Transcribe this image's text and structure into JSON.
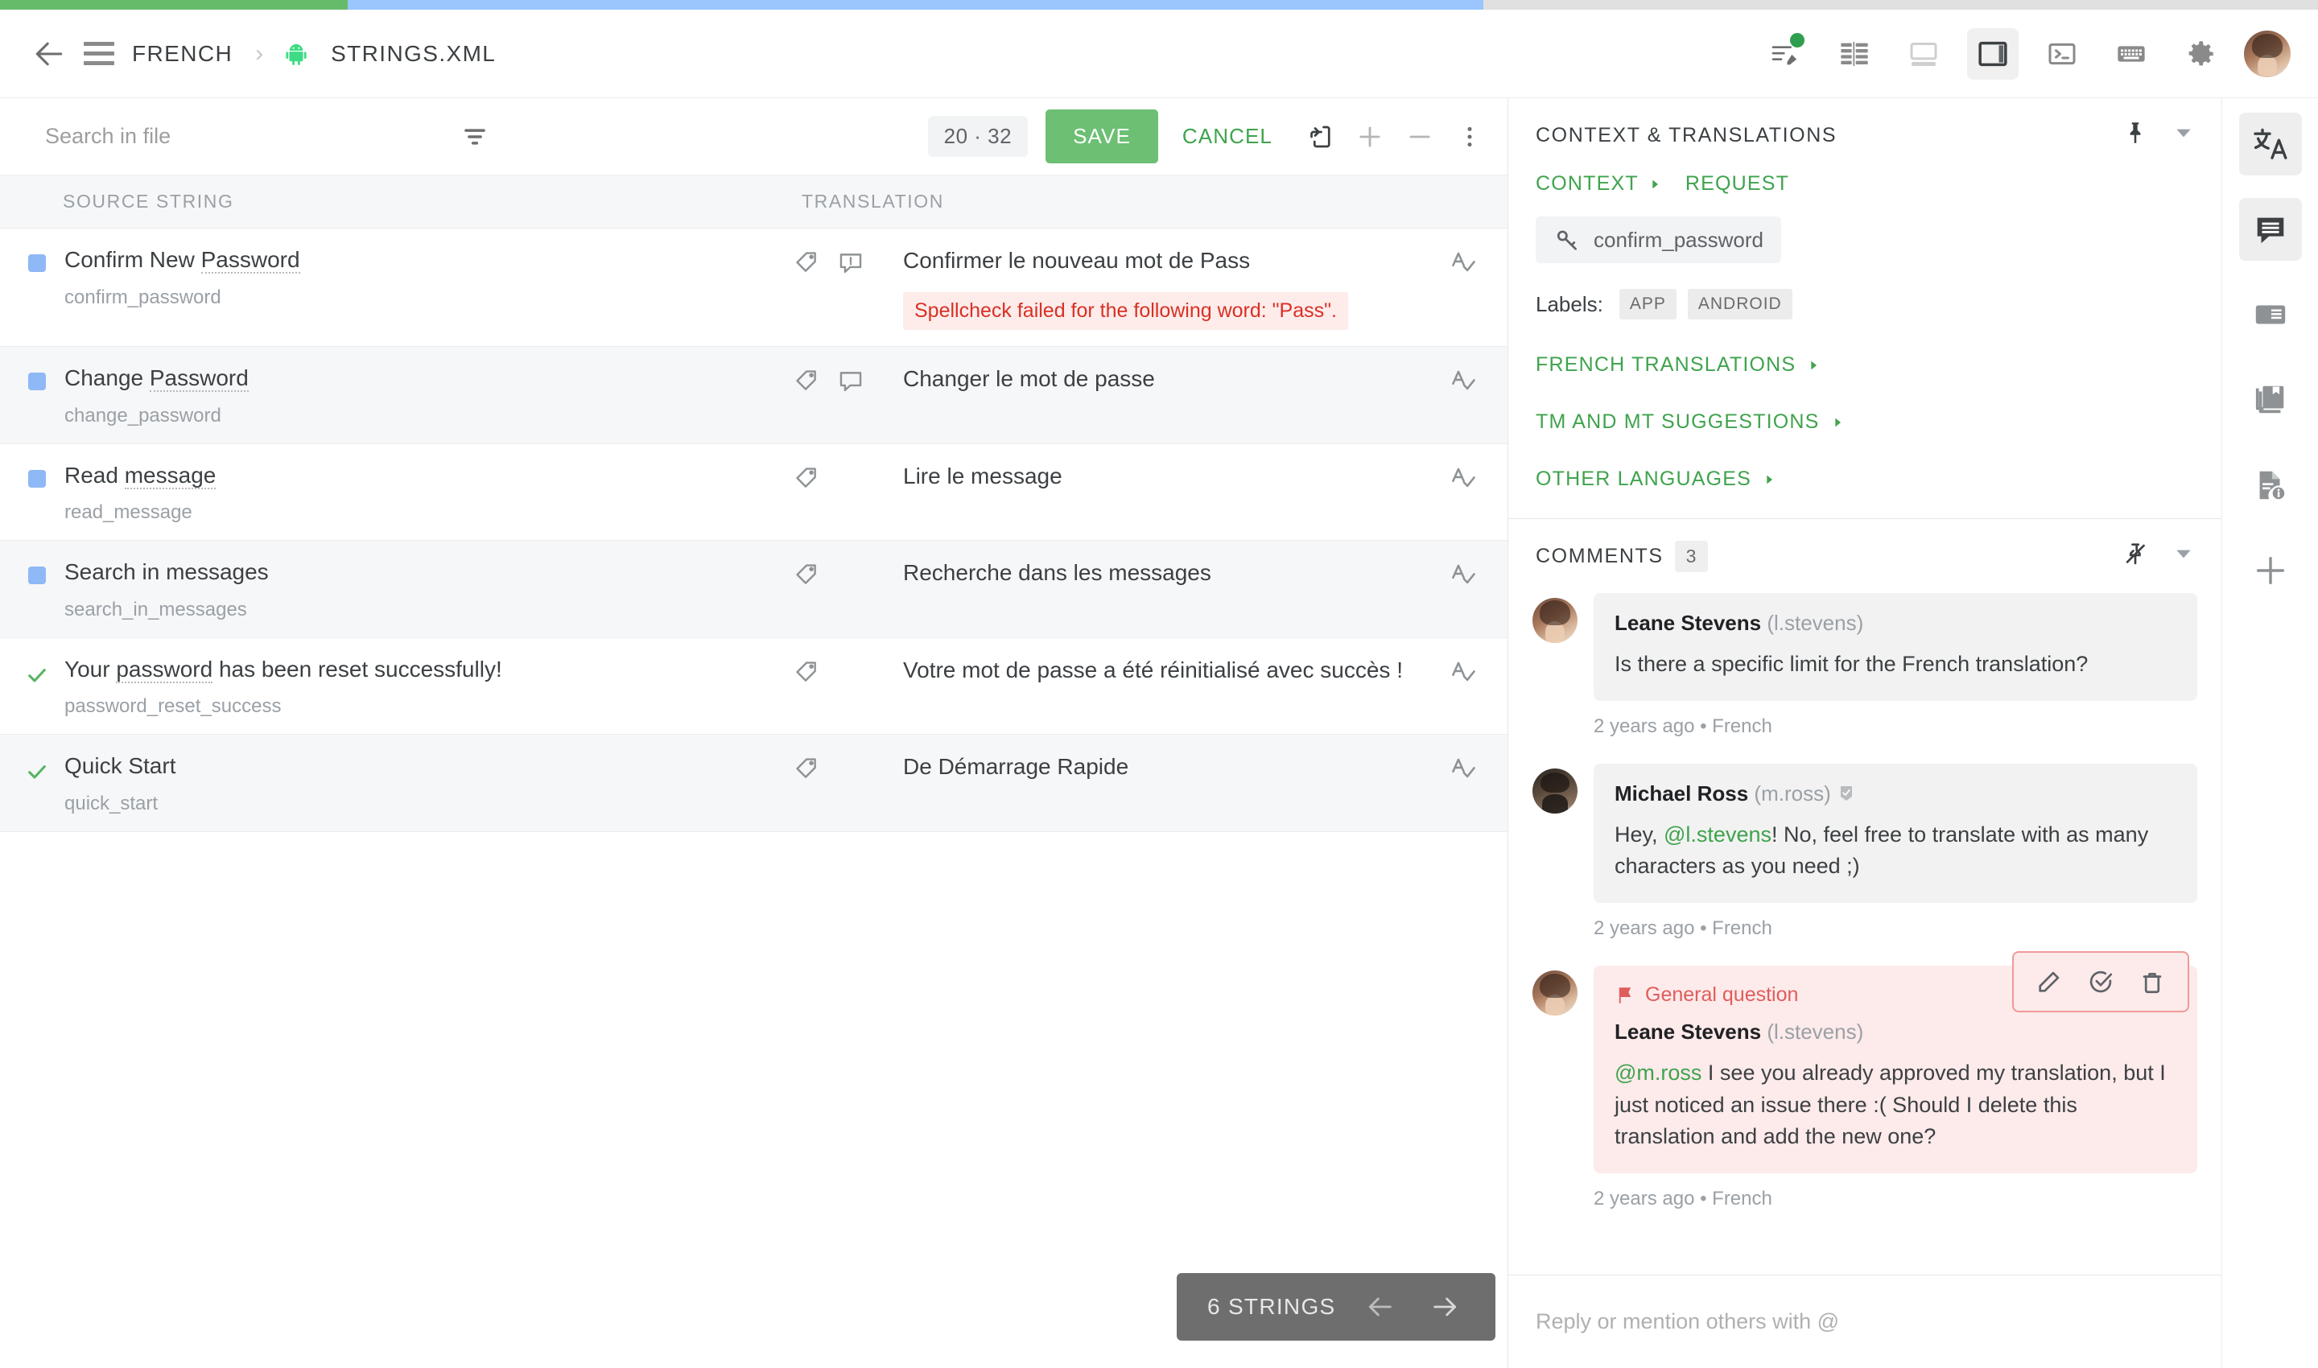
{
  "progress": {
    "green_pct": 15,
    "blue_pct": 49,
    "gray_pct": 36
  },
  "header": {
    "back_icon": "back-arrow-icon",
    "menu_icon": "hamburger-menu-icon",
    "breadcrumb_language": "FRENCH",
    "breadcrumb_separator": "›",
    "android_icon": "android-robot-icon",
    "breadcrumb_file": "STRINGS.XML",
    "tools": [
      {
        "name": "edit-mode-icon",
        "badge": true
      },
      {
        "name": "table-view-icon",
        "badge": false
      },
      {
        "name": "bottom-panel-layout-icon",
        "badge": false
      },
      {
        "name": "side-panel-layout-icon",
        "badge": false,
        "active": true
      },
      {
        "name": "console-icon",
        "badge": false
      },
      {
        "name": "keyboard-shortcuts-icon",
        "badge": false
      },
      {
        "name": "settings-gear-icon",
        "badge": false
      }
    ],
    "avatar": "user-avatar"
  },
  "toolbar": {
    "search_placeholder": "Search in file",
    "search_value": "",
    "filter_icon": "filter-icon",
    "counter": "20 · 32",
    "save_label": "SAVE",
    "cancel_label": "CANCEL",
    "copy_icon": "copy-source-icon",
    "plus_icon": "plus-icon",
    "minus_icon": "minus-icon",
    "more_icon": "more-vertical-icon"
  },
  "list": {
    "col_source": "SOURCE STRING",
    "col_translation": "TRANSLATION",
    "rows": [
      {
        "status": "blue",
        "source_pre": "Confirm New ",
        "source_spell": "Password",
        "source_post": "",
        "key": "confirm_password",
        "icons": [
          "tag-icon",
          "comment-alert-icon"
        ],
        "translation": "Confirmer le nouveau mot de Pass",
        "warning": "Spellcheck failed for the following word: \"Pass\".",
        "right_icon": "spellcheck-icon"
      },
      {
        "status": "blue",
        "source_pre": "Change ",
        "source_spell": "Password",
        "source_post": "",
        "key": "change_password",
        "icons": [
          "tag-icon",
          "comment-icon"
        ],
        "translation": "Changer le mot de passe",
        "warning": "",
        "right_icon": "spellcheck-icon"
      },
      {
        "status": "blue",
        "source_pre": "Read ",
        "source_spell": "message",
        "source_post": "",
        "key": "read_message",
        "icons": [
          "tag-icon"
        ],
        "translation": "Lire le message",
        "warning": "",
        "right_icon": "spellcheck-icon"
      },
      {
        "status": "blue",
        "source_pre": "Search in messages",
        "source_spell": "",
        "source_post": "",
        "key": "search_in_messages",
        "icons": [
          "tag-icon"
        ],
        "translation": "Recherche dans les messages",
        "warning": "",
        "right_icon": "spellcheck-icon"
      },
      {
        "status": "check",
        "source_pre": "Your ",
        "source_spell": "password",
        "source_post": " has been reset successfully!",
        "key": "password_reset_success",
        "icons": [
          "tag-icon"
        ],
        "translation": "Votre mot de passe a été réinitialisé avec succès !",
        "warning": "",
        "right_icon": "spellcheck-icon"
      },
      {
        "status": "check",
        "source_pre": "Quick Start",
        "source_spell": "",
        "source_post": "",
        "key": "quick_start",
        "icons": [
          "tag-icon"
        ],
        "translation": "De Démarrage Rapide",
        "warning": "",
        "right_icon": "spellcheck-icon"
      }
    ],
    "strings_pill": {
      "label": "6 STRINGS",
      "prev_icon": "arrow-left-icon",
      "next_icon": "arrow-right-icon"
    }
  },
  "context_panel": {
    "title": "CONTEXT & TRANSLATIONS",
    "pin_icon": "pin-icon",
    "collapse_icon": "chevron-down-icon",
    "link_context": "CONTEXT",
    "link_request": "REQUEST",
    "key_icon": "key-icon",
    "key_value": "confirm_password",
    "labels_title": "Labels:",
    "labels": [
      "APP",
      "ANDROID"
    ],
    "groups": [
      {
        "label": "FRENCH TRANSLATIONS"
      },
      {
        "label": "TM AND MT SUGGESTIONS"
      },
      {
        "label": "OTHER LANGUAGES"
      }
    ]
  },
  "comments_panel": {
    "title": "COMMENTS",
    "count": "3",
    "unpin_icon": "unpin-icon",
    "collapse_icon": "chevron-down-icon",
    "items": [
      {
        "avatar": "leane-avatar",
        "name": "Leane Stevens",
        "handle": "(l.stevens)",
        "verified": false,
        "flag": "",
        "text_plain": "Is there a specific limit for the French translation?",
        "mention": "",
        "text_after": "",
        "meta": "2 years ago • French",
        "flagged": false
      },
      {
        "avatar": "michael-avatar",
        "name": "Michael Ross",
        "handle": "(m.ross)",
        "verified": true,
        "flag": "",
        "text_before": "Hey, ",
        "mention": "@l.stevens",
        "text_after": "! No, feel free to translate with as many characters as you need ;)",
        "meta": "2 years ago • French",
        "flagged": false
      },
      {
        "avatar": "leane-avatar",
        "name": "Leane Stevens",
        "handle": "(l.stevens)",
        "verified": false,
        "flag_icon": "flag-icon",
        "flag": "General question",
        "text_before": "",
        "mention": "@m.ross",
        "text_after": " I see you already approved my translation, but I just noticed an issue there :( Should I delete this translation and add the new one?",
        "meta": "2 years ago • French",
        "flagged": true,
        "actions": [
          {
            "name": "edit-comment-icon"
          },
          {
            "name": "resolve-comment-icon"
          },
          {
            "name": "delete-comment-icon"
          }
        ]
      }
    ],
    "reply_placeholder": "Reply or mention others with @"
  },
  "right_rail": {
    "items": [
      {
        "name": "translate-icon",
        "active": true
      },
      {
        "name": "comments-icon",
        "active": true
      },
      {
        "name": "screenshot-panel-icon",
        "active": false
      },
      {
        "name": "glossary-book-icon",
        "active": false
      },
      {
        "name": "file-info-icon",
        "active": false
      },
      {
        "name": "add-panel-icon",
        "active": false
      }
    ]
  },
  "colors": {
    "brand_green": "#3fa34d",
    "save_green": "#6cbf73",
    "progress_blue": "#9ac5fd",
    "error_red": "#d93025",
    "flag_red": "#e05c5c",
    "status_blue": "#8fb8f6"
  }
}
